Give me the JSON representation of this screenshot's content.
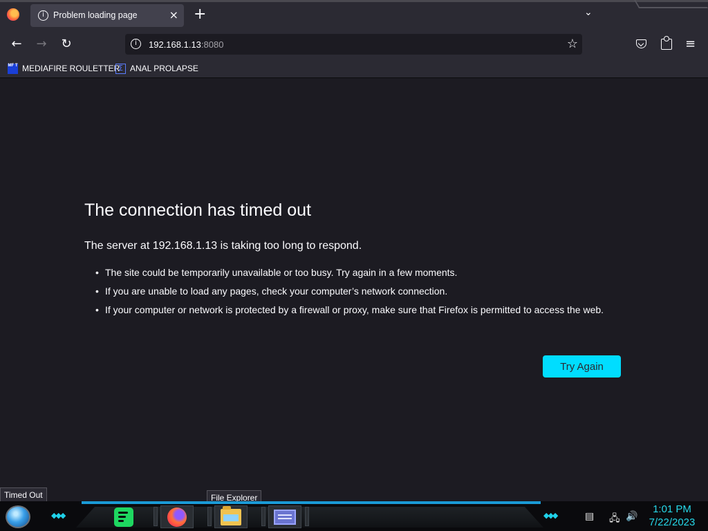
{
  "browser": {
    "tab": {
      "title": "Problem loading page"
    },
    "url": {
      "host": "192.168.1.13",
      "port": ":8080"
    },
    "bookmarks": [
      {
        "label": "MEDIAFIRE ROULETTER",
        "icon": "mediafire-icon",
        "icon_text": "MF T"
      },
      {
        "label": "ANAL PROLAPSE",
        "icon": "sigma-icon"
      }
    ]
  },
  "error_page": {
    "title": "The connection has timed out",
    "description": "The server at 192.168.1.13 is taking too long to respond.",
    "suggestions": [
      "The site could be temporarily unavailable or too busy. Try again in a few moments.",
      "If you are unable to load any pages, check your computer’s network connection.",
      "If your computer or network is protected by a firewall or proxy, make sure that Firefox is permitted to access the web."
    ],
    "button_label": "Try Again",
    "accent_color": "#00ddff"
  },
  "tooltips": {
    "status": "Timed Out",
    "taskbar_hover": "File Explorer"
  },
  "taskbar": {
    "apps": [
      "Spotify",
      "Firefox",
      "File Explorer",
      "Window"
    ],
    "clock": {
      "time": "1:01 PM",
      "date": "7/22/2023"
    },
    "accent_color": "#26d7e8"
  }
}
